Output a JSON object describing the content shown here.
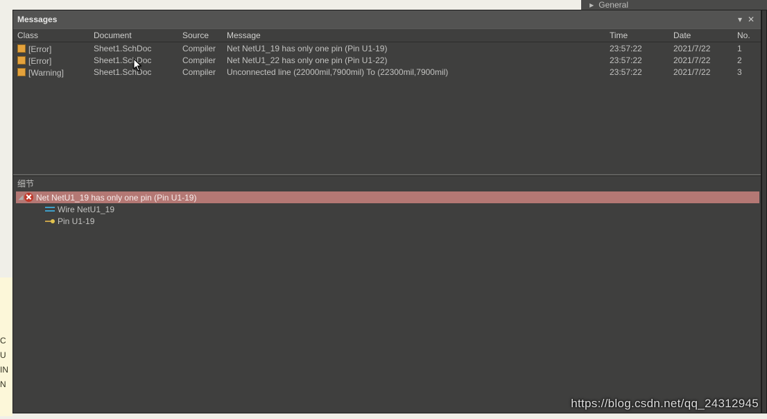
{
  "topTab": {
    "label": "General"
  },
  "panel": {
    "title": "Messages"
  },
  "columns": {
    "class": "Class",
    "document": "Document",
    "source": "Source",
    "message": "Message",
    "time": "Time",
    "date": "Date",
    "no": "No."
  },
  "messages": [
    {
      "class": "[Error]",
      "document": "Sheet1.SchDoc",
      "source": "Compiler",
      "message": "Net NetU1_19 has only one pin (Pin U1-19)",
      "time": "23:57:22",
      "date": "2021/7/22",
      "no": "1"
    },
    {
      "class": "[Error]",
      "document": "Sheet1.SchDoc",
      "source": "Compiler",
      "message": "Net NetU1_22 has only one pin (Pin U1-22)",
      "time": "23:57:22",
      "date": "2021/7/22",
      "no": "2"
    },
    {
      "class": "[Warning]",
      "document": "Sheet1.SchDoc",
      "source": "Compiler",
      "message": "Unconnected line (22000mil,7900mil) To (22300mil,7900mil)",
      "time": "23:57:22",
      "date": "2021/7/22",
      "no": "3"
    }
  ],
  "details": {
    "title": "细节",
    "root": "Net NetU1_19 has only one pin (Pin U1-19)",
    "children": [
      {
        "icon": "wire",
        "label": "Wire NetU1_19"
      },
      {
        "icon": "pin",
        "label": "Pin U1-19"
      }
    ]
  },
  "sideText": "C\nU\nIN\nN",
  "watermark": "https://blog.csdn.net/qq_24312945"
}
